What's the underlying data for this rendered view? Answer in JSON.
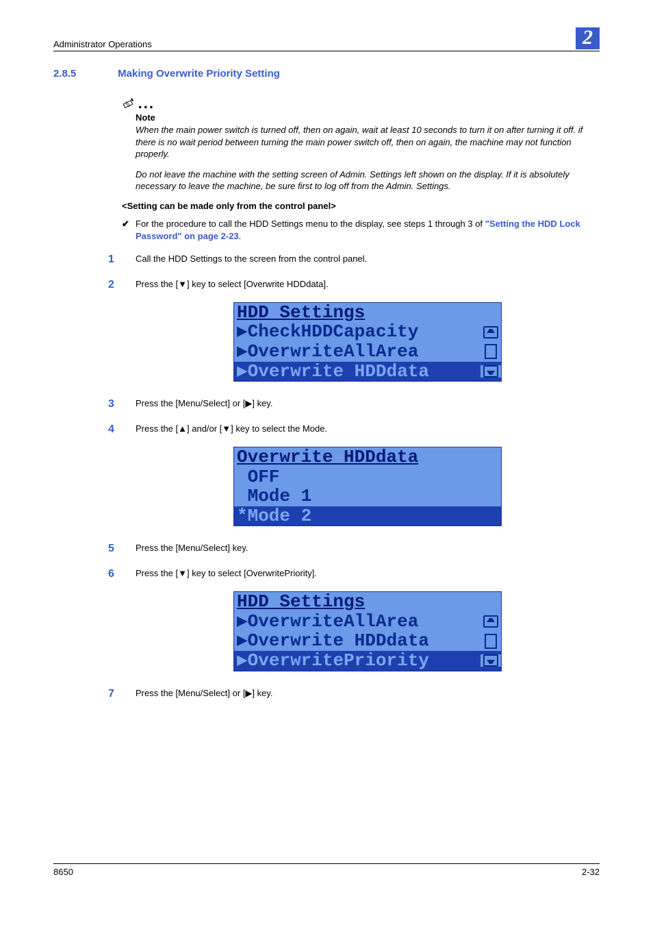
{
  "page": {
    "running_header": "Administrator Operations",
    "chapter_badge": "2",
    "section_number": "2.8.5",
    "section_title": "Making Overwrite Priority Setting",
    "footer_left": "8650",
    "footer_right": "2-32"
  },
  "note": {
    "label": "Note",
    "para1": "When the main power switch is turned off, then on again, wait at least 10 seconds to turn it on after turning it off. if there is no wait period between turning the main power switch off, then on again, the machine may not function properly.",
    "para2": "Do not leave the machine with the setting screen of Admin. Settings left shown on the display. If it is absolutely necessary to leave the machine, be sure first to log off from the Admin. Settings."
  },
  "subheading": "<Setting can be made only from the control panel>",
  "bullet": {
    "pre": "For the procedure to call the HDD Settings menu to the display, see steps 1 through 3 of ",
    "link": "\"Setting the HDD Lock Password\" on page 2-23",
    "post": "."
  },
  "steps": {
    "s1": "Call the HDD Settings to the screen from the control panel.",
    "s2": "Press the [▼] key to select [Overwrite HDDdata].",
    "s3": "Press the [Menu/Select] or [▶] key.",
    "s4": "Press the [▲] and/or [▼] key to select the Mode.",
    "s5": "Press the [Menu/Select] key.",
    "s6": "Press the [▼] key to select [OverwritePriority].",
    "s7": "Press the [Menu/Select] or [▶] key."
  },
  "lcd1": {
    "title": "HDD Settings",
    "r1": "▶CheckHDDCapacity",
    "r2": "▶OverwriteAllArea",
    "r3": "▶Overwrite HDDdata"
  },
  "lcd2": {
    "title": "Overwrite HDDdata",
    "r1": " OFF",
    "r2": " Mode 1",
    "r3": "*Mode 2"
  },
  "lcd3": {
    "title": "HDD Settings",
    "r1": "▶OverwriteAllArea",
    "r2": "▶Overwrite HDDdata",
    "r3": "▶OverwritePriority"
  }
}
